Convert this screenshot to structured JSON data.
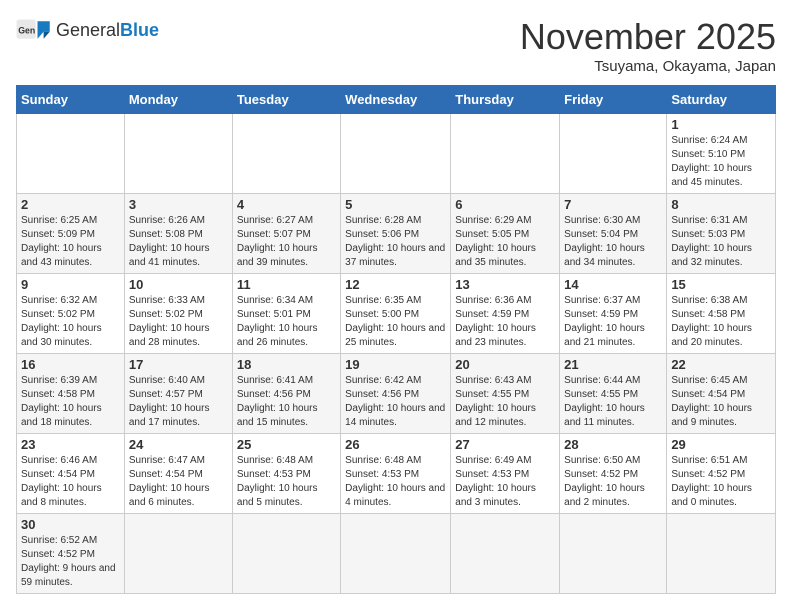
{
  "header": {
    "logo_general": "General",
    "logo_blue": "Blue",
    "month_title": "November 2025",
    "location": "Tsuyama, Okayama, Japan"
  },
  "weekdays": [
    "Sunday",
    "Monday",
    "Tuesday",
    "Wednesday",
    "Thursday",
    "Friday",
    "Saturday"
  ],
  "weeks": [
    [
      {
        "day": "",
        "info": ""
      },
      {
        "day": "",
        "info": ""
      },
      {
        "day": "",
        "info": ""
      },
      {
        "day": "",
        "info": ""
      },
      {
        "day": "",
        "info": ""
      },
      {
        "day": "",
        "info": ""
      },
      {
        "day": "1",
        "info": "Sunrise: 6:24 AM\nSunset: 5:10 PM\nDaylight: 10 hours and 45 minutes."
      }
    ],
    [
      {
        "day": "2",
        "info": "Sunrise: 6:25 AM\nSunset: 5:09 PM\nDaylight: 10 hours and 43 minutes."
      },
      {
        "day": "3",
        "info": "Sunrise: 6:26 AM\nSunset: 5:08 PM\nDaylight: 10 hours and 41 minutes."
      },
      {
        "day": "4",
        "info": "Sunrise: 6:27 AM\nSunset: 5:07 PM\nDaylight: 10 hours and 39 minutes."
      },
      {
        "day": "5",
        "info": "Sunrise: 6:28 AM\nSunset: 5:06 PM\nDaylight: 10 hours and 37 minutes."
      },
      {
        "day": "6",
        "info": "Sunrise: 6:29 AM\nSunset: 5:05 PM\nDaylight: 10 hours and 35 minutes."
      },
      {
        "day": "7",
        "info": "Sunrise: 6:30 AM\nSunset: 5:04 PM\nDaylight: 10 hours and 34 minutes."
      },
      {
        "day": "8",
        "info": "Sunrise: 6:31 AM\nSunset: 5:03 PM\nDaylight: 10 hours and 32 minutes."
      }
    ],
    [
      {
        "day": "9",
        "info": "Sunrise: 6:32 AM\nSunset: 5:02 PM\nDaylight: 10 hours and 30 minutes."
      },
      {
        "day": "10",
        "info": "Sunrise: 6:33 AM\nSunset: 5:02 PM\nDaylight: 10 hours and 28 minutes."
      },
      {
        "day": "11",
        "info": "Sunrise: 6:34 AM\nSunset: 5:01 PM\nDaylight: 10 hours and 26 minutes."
      },
      {
        "day": "12",
        "info": "Sunrise: 6:35 AM\nSunset: 5:00 PM\nDaylight: 10 hours and 25 minutes."
      },
      {
        "day": "13",
        "info": "Sunrise: 6:36 AM\nSunset: 4:59 PM\nDaylight: 10 hours and 23 minutes."
      },
      {
        "day": "14",
        "info": "Sunrise: 6:37 AM\nSunset: 4:59 PM\nDaylight: 10 hours and 21 minutes."
      },
      {
        "day": "15",
        "info": "Sunrise: 6:38 AM\nSunset: 4:58 PM\nDaylight: 10 hours and 20 minutes."
      }
    ],
    [
      {
        "day": "16",
        "info": "Sunrise: 6:39 AM\nSunset: 4:58 PM\nDaylight: 10 hours and 18 minutes."
      },
      {
        "day": "17",
        "info": "Sunrise: 6:40 AM\nSunset: 4:57 PM\nDaylight: 10 hours and 17 minutes."
      },
      {
        "day": "18",
        "info": "Sunrise: 6:41 AM\nSunset: 4:56 PM\nDaylight: 10 hours and 15 minutes."
      },
      {
        "day": "19",
        "info": "Sunrise: 6:42 AM\nSunset: 4:56 PM\nDaylight: 10 hours and 14 minutes."
      },
      {
        "day": "20",
        "info": "Sunrise: 6:43 AM\nSunset: 4:55 PM\nDaylight: 10 hours and 12 minutes."
      },
      {
        "day": "21",
        "info": "Sunrise: 6:44 AM\nSunset: 4:55 PM\nDaylight: 10 hours and 11 minutes."
      },
      {
        "day": "22",
        "info": "Sunrise: 6:45 AM\nSunset: 4:54 PM\nDaylight: 10 hours and 9 minutes."
      }
    ],
    [
      {
        "day": "23",
        "info": "Sunrise: 6:46 AM\nSunset: 4:54 PM\nDaylight: 10 hours and 8 minutes."
      },
      {
        "day": "24",
        "info": "Sunrise: 6:47 AM\nSunset: 4:54 PM\nDaylight: 10 hours and 6 minutes."
      },
      {
        "day": "25",
        "info": "Sunrise: 6:48 AM\nSunset: 4:53 PM\nDaylight: 10 hours and 5 minutes."
      },
      {
        "day": "26",
        "info": "Sunrise: 6:48 AM\nSunset: 4:53 PM\nDaylight: 10 hours and 4 minutes."
      },
      {
        "day": "27",
        "info": "Sunrise: 6:49 AM\nSunset: 4:53 PM\nDaylight: 10 hours and 3 minutes."
      },
      {
        "day": "28",
        "info": "Sunrise: 6:50 AM\nSunset: 4:52 PM\nDaylight: 10 hours and 2 minutes."
      },
      {
        "day": "29",
        "info": "Sunrise: 6:51 AM\nSunset: 4:52 PM\nDaylight: 10 hours and 0 minutes."
      }
    ],
    [
      {
        "day": "30",
        "info": "Sunrise: 6:52 AM\nSunset: 4:52 PM\nDaylight: 9 hours and 59 minutes."
      },
      {
        "day": "",
        "info": ""
      },
      {
        "day": "",
        "info": ""
      },
      {
        "day": "",
        "info": ""
      },
      {
        "day": "",
        "info": ""
      },
      {
        "day": "",
        "info": ""
      },
      {
        "day": "",
        "info": ""
      }
    ]
  ]
}
